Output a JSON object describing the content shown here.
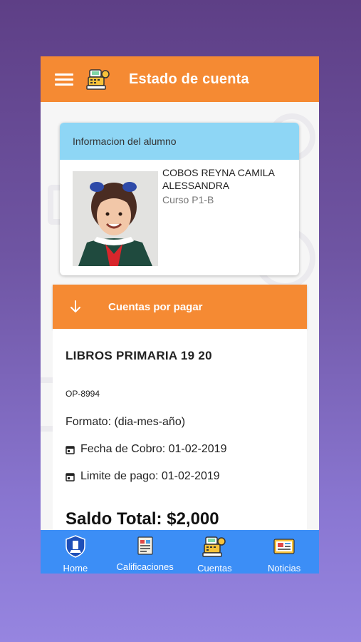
{
  "header": {
    "title": "Estado de cuenta",
    "logo_icon": "cash-register-icon",
    "menu_icon": "hamburger-menu-icon"
  },
  "student_card": {
    "heading": "Informacion del alumno",
    "name": "COBOS REYNA CAMILA ALESSANDRA",
    "course": "Curso P1-B"
  },
  "accounts_section": {
    "label": "Cuentas por pagar",
    "icon": "arrow-down-icon"
  },
  "bill": {
    "concept": "LIBROS PRIMARIA 19 20",
    "reference": "OP-8994",
    "format_note": "Formato: (dia-mes-año)",
    "charge_date": "Fecha de Cobro: 01-02-2019",
    "due_date": "Limite de pago: 01-02-2019",
    "total": "Saldo Total: $2,000"
  },
  "bottom_nav": {
    "items": [
      {
        "label": "Home",
        "icon": "school-shield-icon"
      },
      {
        "label": "Calificaciones",
        "icon": "report-card-icon"
      },
      {
        "label": "Cuentas",
        "icon": "cash-register-icon"
      },
      {
        "label": "Noticias",
        "icon": "newspaper-icon"
      }
    ]
  },
  "colors": {
    "appbar": "#f58a33",
    "card_header": "#8ed6f5",
    "bottom_nav": "#3c8ef6"
  }
}
